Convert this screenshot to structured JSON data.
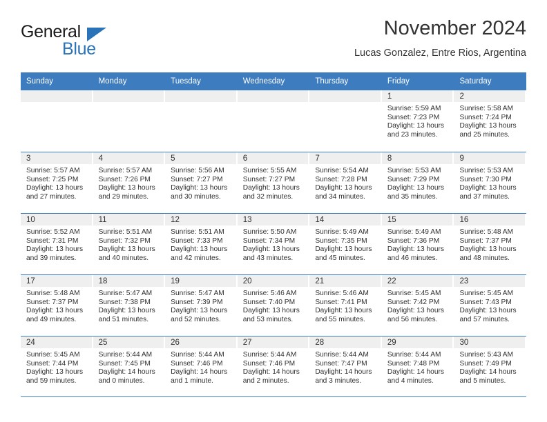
{
  "logo": {
    "word_one": "General",
    "word_two": "Blue",
    "triangle_color": "#2a73b8"
  },
  "header": {
    "title": "November 2024",
    "subtitle": "Lucas Gonzalez, Entre Rios, Argentina",
    "header_bg_color": "#3c7cbf",
    "day_band_color": "#efefef"
  },
  "weekdays": [
    "Sunday",
    "Monday",
    "Tuesday",
    "Wednesday",
    "Thursday",
    "Friday",
    "Saturday"
  ],
  "weeks": [
    [
      {
        "day": "",
        "sunrise": "",
        "sunset": "",
        "daylight_1": "",
        "daylight_2": ""
      },
      {
        "day": "",
        "sunrise": "",
        "sunset": "",
        "daylight_1": "",
        "daylight_2": ""
      },
      {
        "day": "",
        "sunrise": "",
        "sunset": "",
        "daylight_1": "",
        "daylight_2": ""
      },
      {
        "day": "",
        "sunrise": "",
        "sunset": "",
        "daylight_1": "",
        "daylight_2": ""
      },
      {
        "day": "",
        "sunrise": "",
        "sunset": "",
        "daylight_1": "",
        "daylight_2": ""
      },
      {
        "day": "1",
        "sunrise": "Sunrise: 5:59 AM",
        "sunset": "Sunset: 7:23 PM",
        "daylight_1": "Daylight: 13 hours",
        "daylight_2": "and 23 minutes."
      },
      {
        "day": "2",
        "sunrise": "Sunrise: 5:58 AM",
        "sunset": "Sunset: 7:24 PM",
        "daylight_1": "Daylight: 13 hours",
        "daylight_2": "and 25 minutes."
      }
    ],
    [
      {
        "day": "3",
        "sunrise": "Sunrise: 5:57 AM",
        "sunset": "Sunset: 7:25 PM",
        "daylight_1": "Daylight: 13 hours",
        "daylight_2": "and 27 minutes."
      },
      {
        "day": "4",
        "sunrise": "Sunrise: 5:57 AM",
        "sunset": "Sunset: 7:26 PM",
        "daylight_1": "Daylight: 13 hours",
        "daylight_2": "and 29 minutes."
      },
      {
        "day": "5",
        "sunrise": "Sunrise: 5:56 AM",
        "sunset": "Sunset: 7:27 PM",
        "daylight_1": "Daylight: 13 hours",
        "daylight_2": "and 30 minutes."
      },
      {
        "day": "6",
        "sunrise": "Sunrise: 5:55 AM",
        "sunset": "Sunset: 7:27 PM",
        "daylight_1": "Daylight: 13 hours",
        "daylight_2": "and 32 minutes."
      },
      {
        "day": "7",
        "sunrise": "Sunrise: 5:54 AM",
        "sunset": "Sunset: 7:28 PM",
        "daylight_1": "Daylight: 13 hours",
        "daylight_2": "and 34 minutes."
      },
      {
        "day": "8",
        "sunrise": "Sunrise: 5:53 AM",
        "sunset": "Sunset: 7:29 PM",
        "daylight_1": "Daylight: 13 hours",
        "daylight_2": "and 35 minutes."
      },
      {
        "day": "9",
        "sunrise": "Sunrise: 5:53 AM",
        "sunset": "Sunset: 7:30 PM",
        "daylight_1": "Daylight: 13 hours",
        "daylight_2": "and 37 minutes."
      }
    ],
    [
      {
        "day": "10",
        "sunrise": "Sunrise: 5:52 AM",
        "sunset": "Sunset: 7:31 PM",
        "daylight_1": "Daylight: 13 hours",
        "daylight_2": "and 39 minutes."
      },
      {
        "day": "11",
        "sunrise": "Sunrise: 5:51 AM",
        "sunset": "Sunset: 7:32 PM",
        "daylight_1": "Daylight: 13 hours",
        "daylight_2": "and 40 minutes."
      },
      {
        "day": "12",
        "sunrise": "Sunrise: 5:51 AM",
        "sunset": "Sunset: 7:33 PM",
        "daylight_1": "Daylight: 13 hours",
        "daylight_2": "and 42 minutes."
      },
      {
        "day": "13",
        "sunrise": "Sunrise: 5:50 AM",
        "sunset": "Sunset: 7:34 PM",
        "daylight_1": "Daylight: 13 hours",
        "daylight_2": "and 43 minutes."
      },
      {
        "day": "14",
        "sunrise": "Sunrise: 5:49 AM",
        "sunset": "Sunset: 7:35 PM",
        "daylight_1": "Daylight: 13 hours",
        "daylight_2": "and 45 minutes."
      },
      {
        "day": "15",
        "sunrise": "Sunrise: 5:49 AM",
        "sunset": "Sunset: 7:36 PM",
        "daylight_1": "Daylight: 13 hours",
        "daylight_2": "and 46 minutes."
      },
      {
        "day": "16",
        "sunrise": "Sunrise: 5:48 AM",
        "sunset": "Sunset: 7:37 PM",
        "daylight_1": "Daylight: 13 hours",
        "daylight_2": "and 48 minutes."
      }
    ],
    [
      {
        "day": "17",
        "sunrise": "Sunrise: 5:48 AM",
        "sunset": "Sunset: 7:37 PM",
        "daylight_1": "Daylight: 13 hours",
        "daylight_2": "and 49 minutes."
      },
      {
        "day": "18",
        "sunrise": "Sunrise: 5:47 AM",
        "sunset": "Sunset: 7:38 PM",
        "daylight_1": "Daylight: 13 hours",
        "daylight_2": "and 51 minutes."
      },
      {
        "day": "19",
        "sunrise": "Sunrise: 5:47 AM",
        "sunset": "Sunset: 7:39 PM",
        "daylight_1": "Daylight: 13 hours",
        "daylight_2": "and 52 minutes."
      },
      {
        "day": "20",
        "sunrise": "Sunrise: 5:46 AM",
        "sunset": "Sunset: 7:40 PM",
        "daylight_1": "Daylight: 13 hours",
        "daylight_2": "and 53 minutes."
      },
      {
        "day": "21",
        "sunrise": "Sunrise: 5:46 AM",
        "sunset": "Sunset: 7:41 PM",
        "daylight_1": "Daylight: 13 hours",
        "daylight_2": "and 55 minutes."
      },
      {
        "day": "22",
        "sunrise": "Sunrise: 5:45 AM",
        "sunset": "Sunset: 7:42 PM",
        "daylight_1": "Daylight: 13 hours",
        "daylight_2": "and 56 minutes."
      },
      {
        "day": "23",
        "sunrise": "Sunrise: 5:45 AM",
        "sunset": "Sunset: 7:43 PM",
        "daylight_1": "Daylight: 13 hours",
        "daylight_2": "and 57 minutes."
      }
    ],
    [
      {
        "day": "24",
        "sunrise": "Sunrise: 5:45 AM",
        "sunset": "Sunset: 7:44 PM",
        "daylight_1": "Daylight: 13 hours",
        "daylight_2": "and 59 minutes."
      },
      {
        "day": "25",
        "sunrise": "Sunrise: 5:44 AM",
        "sunset": "Sunset: 7:45 PM",
        "daylight_1": "Daylight: 14 hours",
        "daylight_2": "and 0 minutes."
      },
      {
        "day": "26",
        "sunrise": "Sunrise: 5:44 AM",
        "sunset": "Sunset: 7:46 PM",
        "daylight_1": "Daylight: 14 hours",
        "daylight_2": "and 1 minute."
      },
      {
        "day": "27",
        "sunrise": "Sunrise: 5:44 AM",
        "sunset": "Sunset: 7:46 PM",
        "daylight_1": "Daylight: 14 hours",
        "daylight_2": "and 2 minutes."
      },
      {
        "day": "28",
        "sunrise": "Sunrise: 5:44 AM",
        "sunset": "Sunset: 7:47 PM",
        "daylight_1": "Daylight: 14 hours",
        "daylight_2": "and 3 minutes."
      },
      {
        "day": "29",
        "sunrise": "Sunrise: 5:44 AM",
        "sunset": "Sunset: 7:48 PM",
        "daylight_1": "Daylight: 14 hours",
        "daylight_2": "and 4 minutes."
      },
      {
        "day": "30",
        "sunrise": "Sunrise: 5:43 AM",
        "sunset": "Sunset: 7:49 PM",
        "daylight_1": "Daylight: 14 hours",
        "daylight_2": "and 5 minutes."
      }
    ]
  ]
}
